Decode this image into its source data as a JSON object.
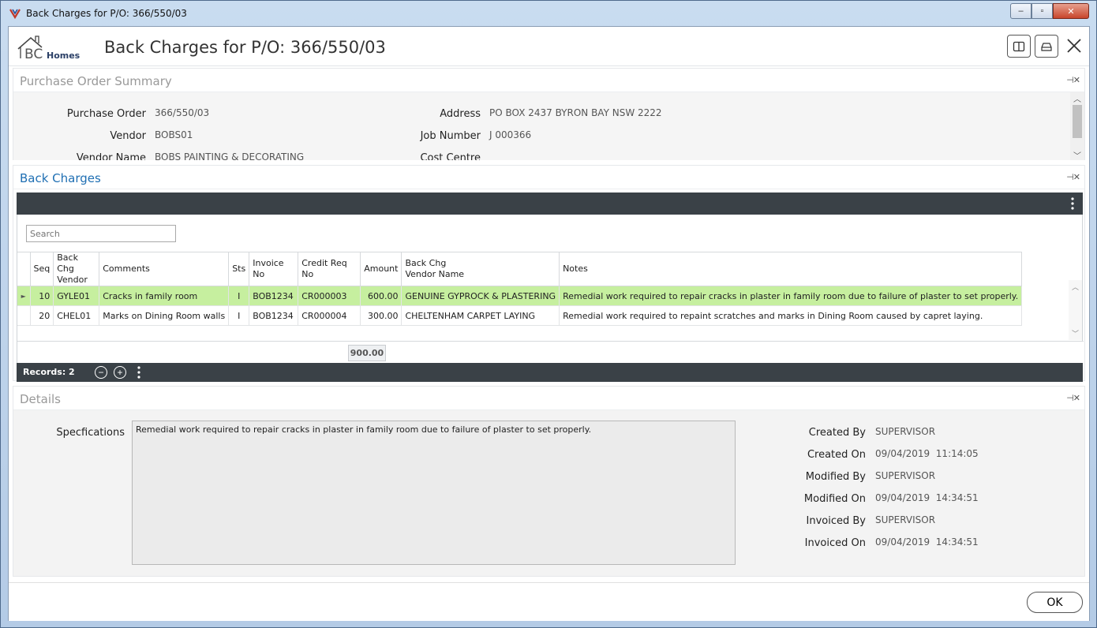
{
  "window": {
    "title": "Back Charges for P/O: 366/550/03",
    "minimize_glyph": "–",
    "maximize_glyph": "▫",
    "close_glyph": "✕"
  },
  "header": {
    "logo_text_bc": "BC",
    "logo_text_homes": "Homes",
    "title": "Back Charges for P/O: 366/550/03"
  },
  "po_summary": {
    "title": "Purchase Order Summary",
    "pin_glyph": "⊣✕",
    "fields": {
      "purchase_order_label": "Purchase Order",
      "purchase_order_value": "366/550/03",
      "vendor_label": "Vendor",
      "vendor_value": "BOBS01",
      "vendor_name_label": "Vendor Name",
      "vendor_name_value": "BOBS PAINTING & DECORATING",
      "address_label": "Address",
      "address_value": "PO BOX 2437 BYRON BAY NSW 2222",
      "job_number_label": "Job Number",
      "job_number_value": "J 000366",
      "cost_centre_label": "Cost Centre"
    }
  },
  "back_charges": {
    "title": "Back Charges",
    "pin_glyph": "⊣✕",
    "search_placeholder": "Search",
    "columns": [
      "Seq",
      "Back Chg Vendor",
      "Comments",
      "Sts",
      "Invoice No",
      "Credit Req No",
      "Amount",
      "Back Chg Vendor Name",
      "Notes"
    ],
    "col_back_chg_1": "Back Chg",
    "col_back_chg_2": "Vendor",
    "col_back_chg_name_1": "Back Chg",
    "col_back_chg_name_2": "Vendor Name",
    "rows": [
      {
        "seq": "10",
        "vendor": "GYLE01",
        "comments": "Cracks in family room",
        "sts": "I",
        "invoice_no": "BOB1234",
        "credit_req_no": "CR000003",
        "amount": "600.00",
        "vendor_name": "GENUINE GYPROCK & PLASTERING",
        "notes": "Remedial work required to repair cracks in plaster in family room due to failure of plaster to set properly."
      },
      {
        "seq": "20",
        "vendor": "CHEL01",
        "comments": "Marks on Dining Room walls",
        "sts": "I",
        "invoice_no": "BOB1234",
        "credit_req_no": "CR000004",
        "amount": "300.00",
        "vendor_name": "CHELTENHAM CARPET LAYING",
        "notes": "Remedial work required to repaint scratches and marks in Dining Room caused by capret laying."
      }
    ],
    "total_amount": "900.00",
    "records_label": "Records:",
    "records_count": "2",
    "remove_glyph": "−",
    "add_glyph": "+"
  },
  "details": {
    "title": "Details",
    "pin_glyph": "⊣✕",
    "spec_label": "Specfications",
    "spec_value": "Remedial work required to repair cracks in plaster in family room due to failure of plaster to set properly.",
    "created_by_label": "Created By",
    "created_by_value": "SUPERVISOR",
    "created_on_label": "Created On",
    "created_on_value": "09/04/2019  11:14:05",
    "modified_by_label": "Modified By",
    "modified_by_value": "SUPERVISOR",
    "modified_on_label": "Modified On",
    "modified_on_value": "09/04/2019  14:34:51",
    "invoiced_by_label": "Invoiced By",
    "invoiced_by_value": "SUPERVISOR",
    "invoiced_on_label": "Invoiced On",
    "invoiced_on_value": "09/04/2019  14:34:51"
  },
  "footer": {
    "ok_label": "OK"
  },
  "colors": {
    "selected_row": "#c6ef9f",
    "toolbar_dark": "#3a4147",
    "section_title_blue": "#1f6fb3"
  },
  "icons": [
    "app-icon",
    "minimize-icon",
    "maximize-icon",
    "window-close-icon",
    "split-view-icon",
    "drawer-icon",
    "close-icon",
    "pin-close-icon",
    "kebab-menu-icon",
    "row-indicator-icon",
    "remove-record-icon",
    "add-record-icon"
  ]
}
